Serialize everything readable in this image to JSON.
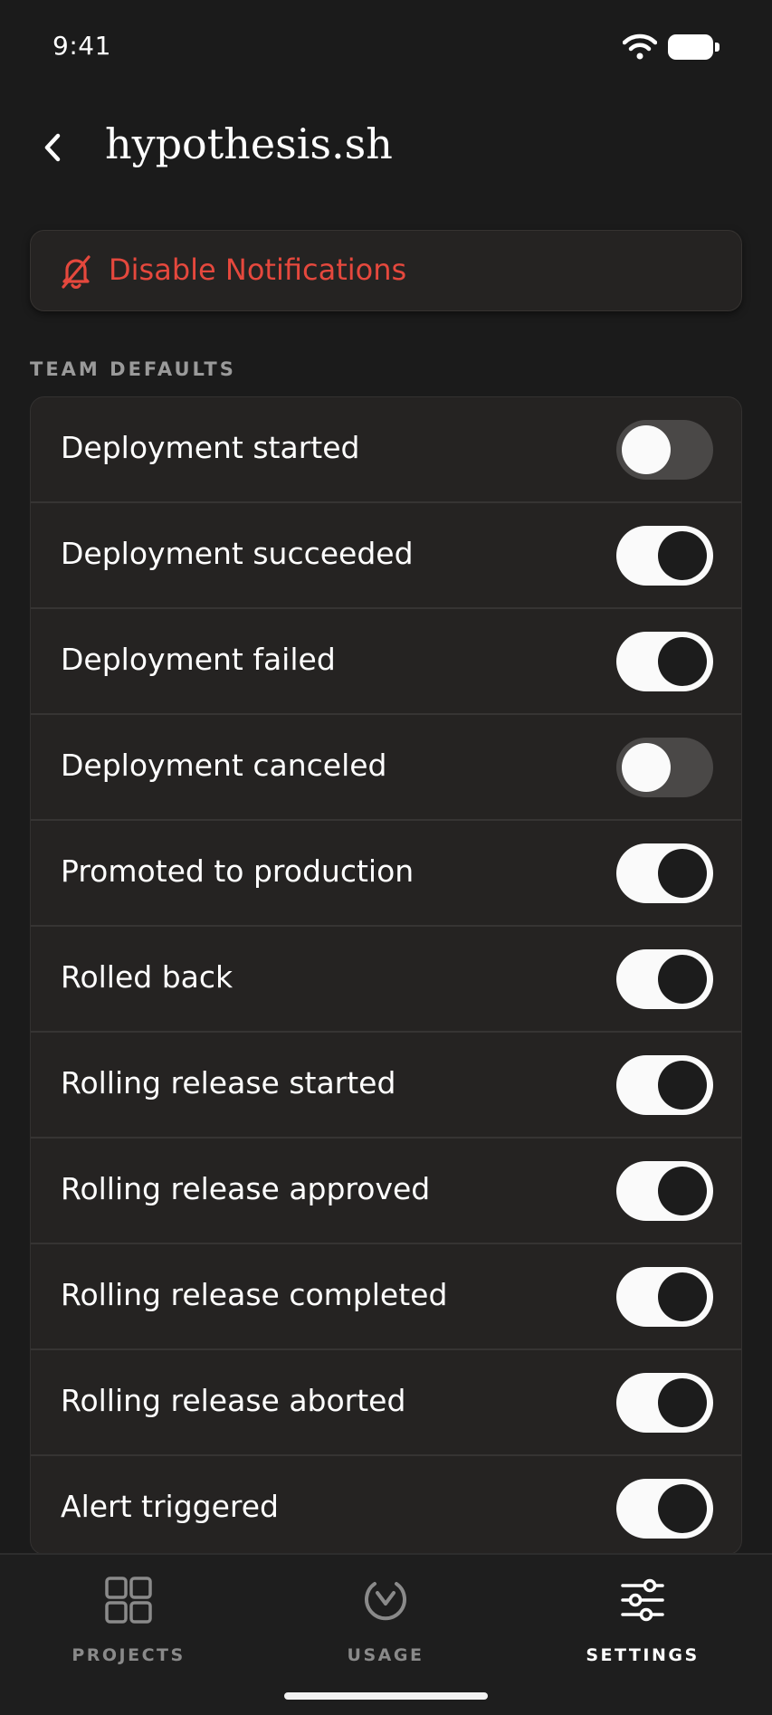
{
  "status_bar": {
    "time": "9:41"
  },
  "header": {
    "title": "hypothesis.sh"
  },
  "disable_button": {
    "label": "Disable Notifications"
  },
  "section": {
    "label": "TEAM DEFAULTS"
  },
  "toggles": [
    {
      "label": "Deployment started",
      "enabled": false
    },
    {
      "label": "Deployment succeeded",
      "enabled": true
    },
    {
      "label": "Deployment failed",
      "enabled": true
    },
    {
      "label": "Deployment canceled",
      "enabled": false
    },
    {
      "label": "Promoted to production",
      "enabled": true
    },
    {
      "label": "Rolled back",
      "enabled": true
    },
    {
      "label": "Rolling release started",
      "enabled": true
    },
    {
      "label": "Rolling release approved",
      "enabled": true
    },
    {
      "label": "Rolling release completed",
      "enabled": true
    },
    {
      "label": "Rolling release aborted",
      "enabled": true
    },
    {
      "label": "Alert triggered",
      "enabled": true
    }
  ],
  "tabs": [
    {
      "label": "PROJECTS",
      "icon": "grid-icon",
      "active": false
    },
    {
      "label": "USAGE",
      "icon": "gauge-icon",
      "active": false
    },
    {
      "label": "SETTINGS",
      "icon": "sliders-icon",
      "active": true
    }
  ],
  "colors": {
    "background": "#1b1b1b",
    "card": "#252322",
    "danger": "#e5483d",
    "toggle_on": "#fafafa",
    "toggle_off": "#4a4847"
  }
}
